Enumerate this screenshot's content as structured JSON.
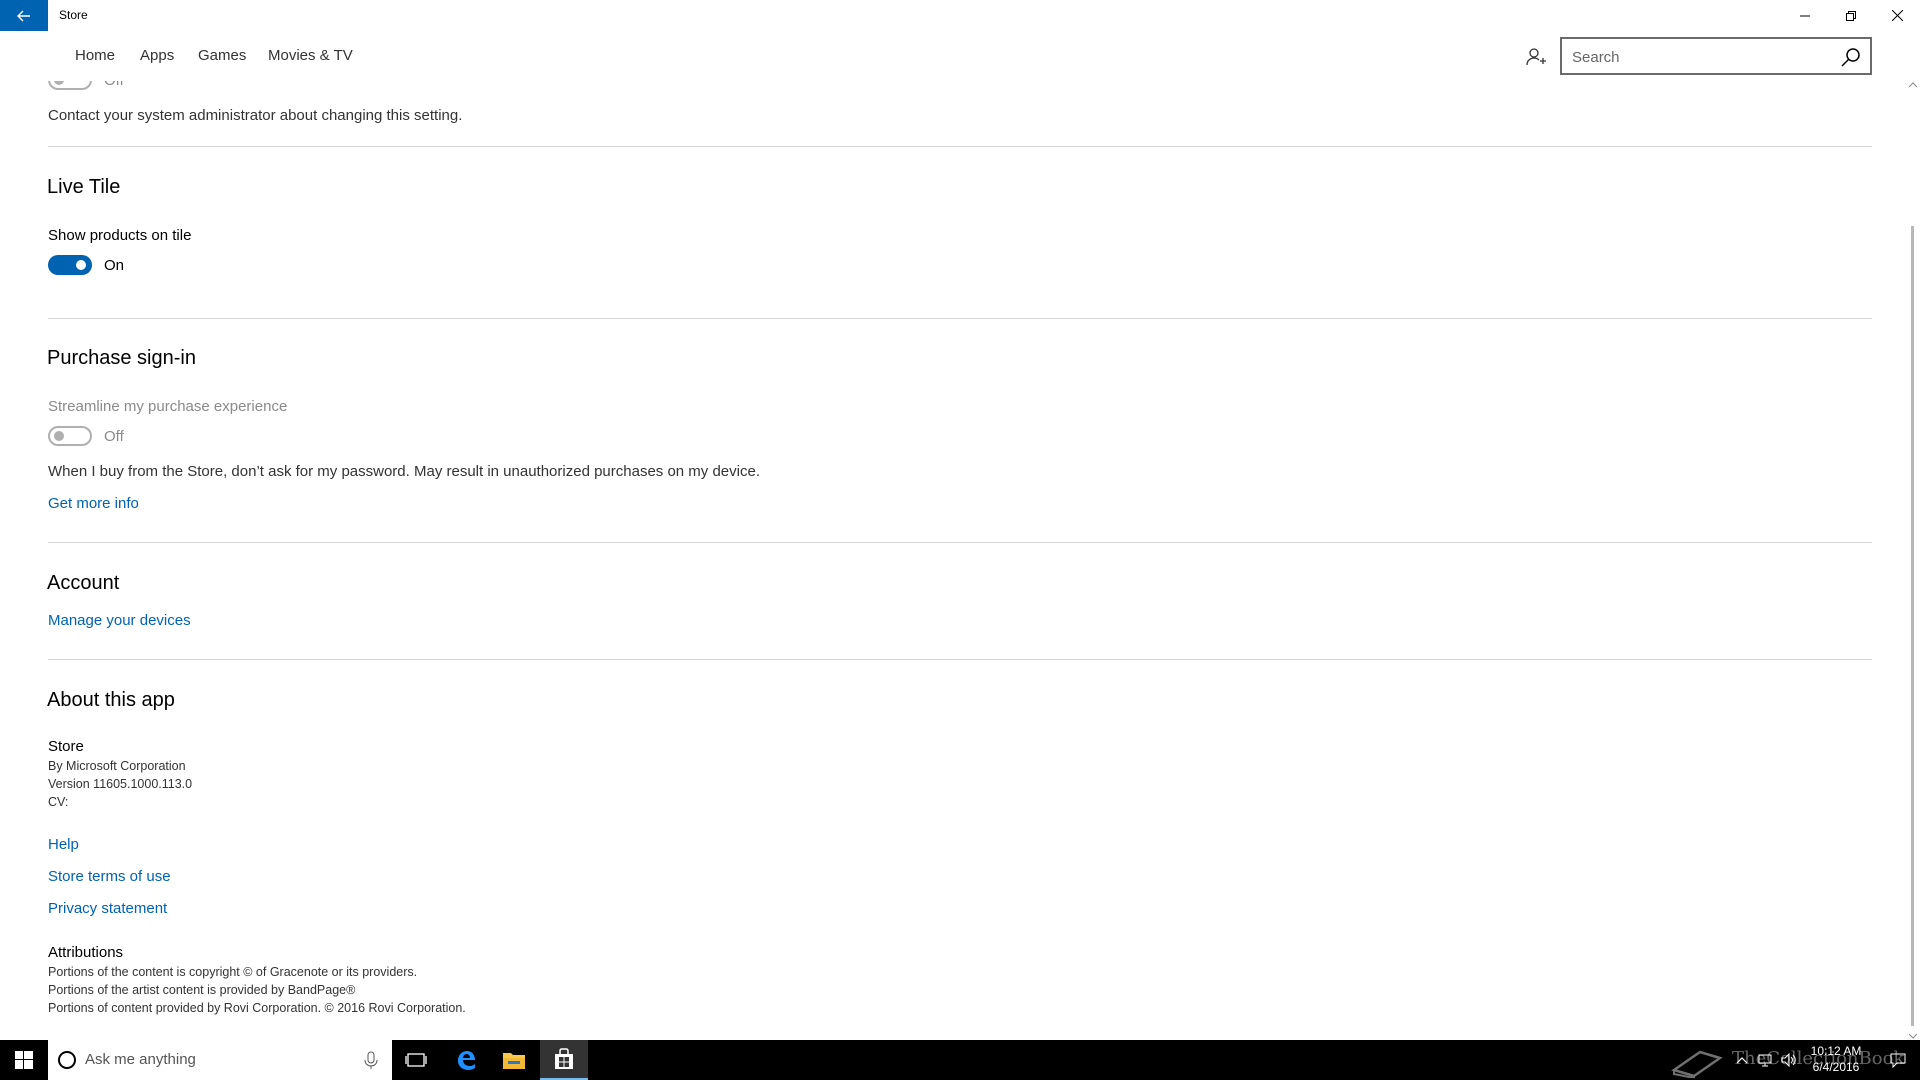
{
  "window": {
    "title": "Store"
  },
  "nav": {
    "items": [
      "Home",
      "Apps",
      "Games",
      "Movies & TV"
    ],
    "search_placeholder": "Search"
  },
  "top_partial": {
    "toggle_state": "Off",
    "admin_note": "Contact your system administrator about changing this setting."
  },
  "live_tile": {
    "title": "Live Tile",
    "label": "Show products on tile",
    "toggle_state": "On"
  },
  "purchase": {
    "title": "Purchase sign-in",
    "label": "Streamline my purchase experience",
    "toggle_state": "Off",
    "desc": "When I buy from the Store, don’t ask for my password. May result in unauthorized purchases on my device.",
    "link": "Get more info"
  },
  "account": {
    "title": "Account",
    "link": "Manage your devices"
  },
  "about": {
    "title": "About this app",
    "app_name": "Store",
    "publisher": "By Microsoft Corporation",
    "version": "Version 11605.1000.113.0",
    "cv": "CV:",
    "links": [
      "Help",
      "Store terms of use",
      "Privacy statement"
    ],
    "attributions_title": "Attributions",
    "attributions": [
      "Portions of the content is copyright © of Gracenote or its providers.",
      "Portions of the artist content is provided by BandPage®",
      "Portions of content provided by Rovi Corporation. © 2016 Rovi Corporation."
    ]
  },
  "taskbar": {
    "search_placeholder": "Ask me anything",
    "time": "10:12 AM",
    "date": "6/4/2016",
    "watermark": "TheCollectionBook"
  },
  "colors": {
    "accent": "#0063b1",
    "taskbar": "#000000"
  }
}
